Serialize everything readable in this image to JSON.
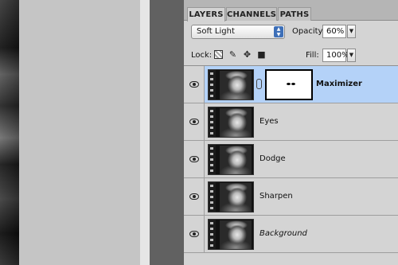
{
  "tabs": [
    {
      "label": "LAYERS",
      "active": true
    },
    {
      "label": "CHANNELS",
      "active": false
    },
    {
      "label": "PATHS",
      "active": false
    }
  ],
  "blend": {
    "mode": "Soft Light",
    "opacity_label": "Opacity:",
    "opacity_value": "60%"
  },
  "lock": {
    "label": "Lock:",
    "icons": [
      "lock-transparent-icon",
      "lock-image-icon",
      "lock-position-icon",
      "lock-all-icon"
    ]
  },
  "fill": {
    "label": "Fill:",
    "value": "100%"
  },
  "layers": [
    {
      "name": "Maximizer",
      "selected": true,
      "has_mask": true,
      "style": "bold"
    },
    {
      "name": "Eyes",
      "selected": false,
      "has_mask": false,
      "style": "normal"
    },
    {
      "name": "Dodge",
      "selected": false,
      "has_mask": false,
      "style": "normal"
    },
    {
      "name": "Sharpen",
      "selected": false,
      "has_mask": false,
      "style": "normal"
    },
    {
      "name": "Background",
      "selected": false,
      "has_mask": false,
      "style": "italic"
    }
  ],
  "colors": {
    "selected_row": "#b4d2f8",
    "panel_bg": "#d4d4d4",
    "select_arrows": "#3d6fb8"
  }
}
